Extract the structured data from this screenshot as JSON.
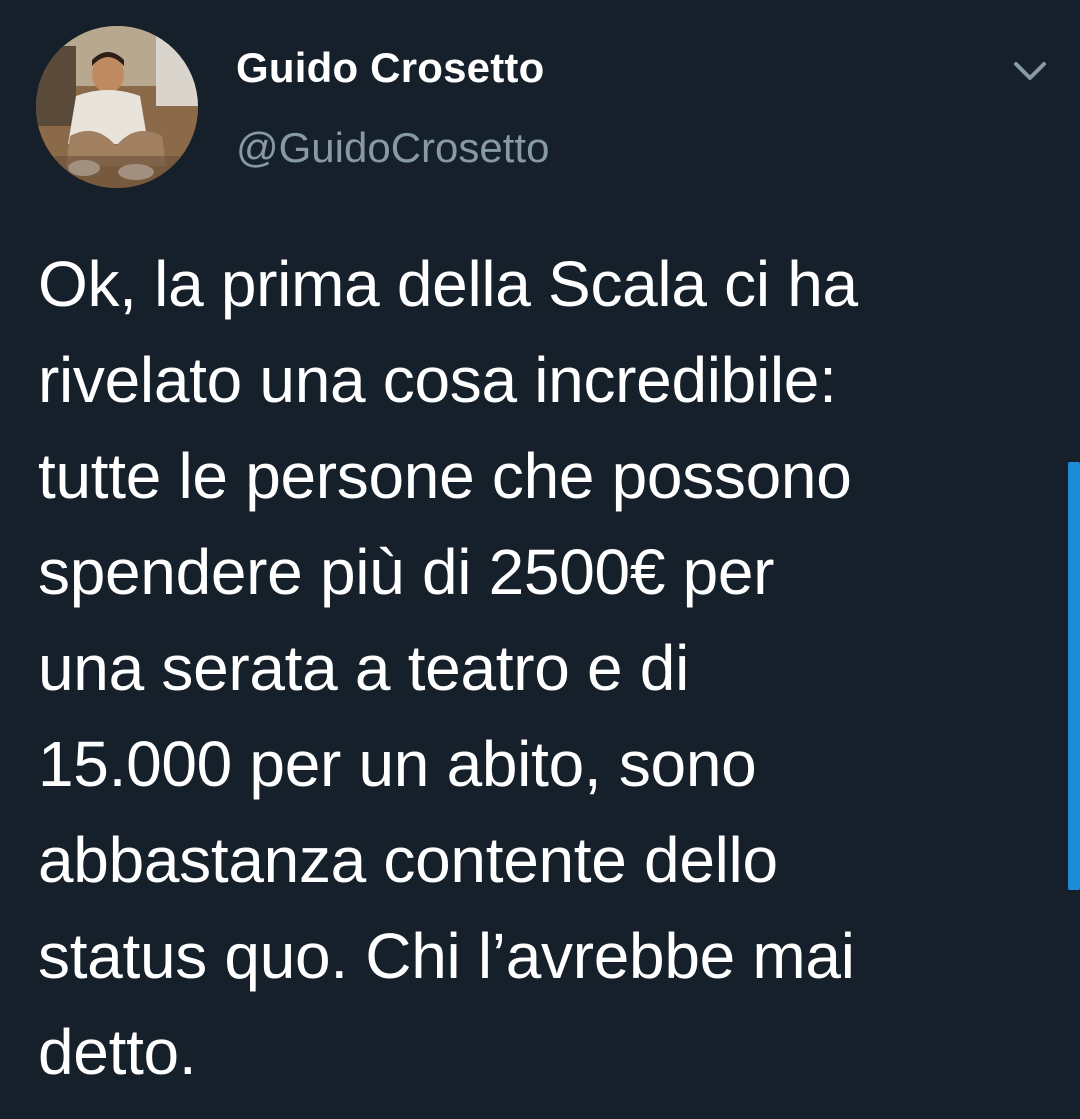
{
  "tweet": {
    "author": {
      "display_name": "Guido Crosetto",
      "handle": "@GuidoCrosetto",
      "avatar_icon": "avatar-photo"
    },
    "menu_icon": "chevron-down-icon",
    "text_lines": [
      "Ok, la prima della Scala ci ha",
      "rivelato una cosa incredibile:",
      "tutte le persone che possono",
      "spendere più di 2500€ per",
      "una serata a teatro e di",
      "15.000 per un abito, sono",
      "abbastanza contente dello",
      "status quo. Chi l’avrebbe mai",
      "detto."
    ]
  },
  "colors": {
    "background": "#15202b",
    "primary_text": "#ffffff",
    "secondary_text": "#8899a6",
    "accent": "#1da1f2"
  }
}
